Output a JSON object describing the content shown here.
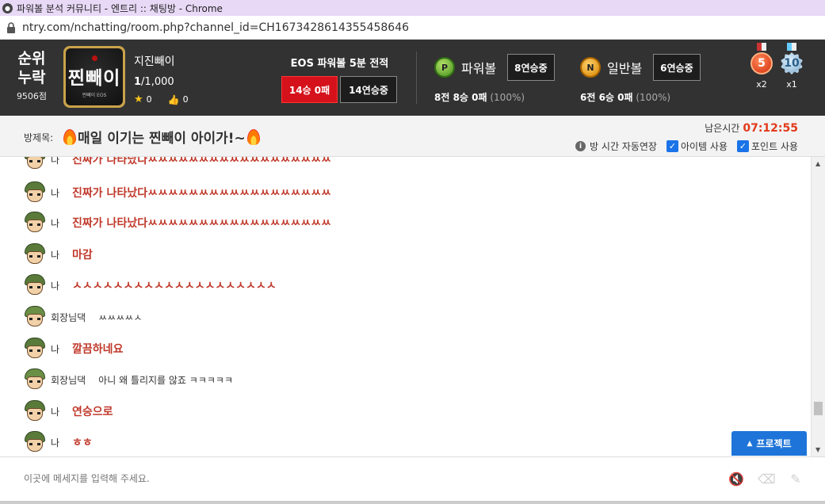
{
  "window": {
    "title": "파워볼 분석 커뮤니티 - 엔트리 :: 채팅방 - Chrome",
    "url": "ntry.com/nchatting/room.php?channel_id=CH1673428614355458646"
  },
  "header": {
    "rank_line1": "순위",
    "rank_line2": "누락",
    "points": "9506점",
    "avatar_text": "찐빼이",
    "avatar_sub": "찐빼이 EOS",
    "nickname": "지진빼이",
    "level_cur": "1",
    "level_rest": "/1,000",
    "stars": "0",
    "likes": "0",
    "eos_title": "EOS 파워볼 5분 전적",
    "eos_record": "14승 0패",
    "eos_streak": "14연승중",
    "powerball": {
      "badge": "P",
      "label": "파워볼",
      "streak": "8연승중",
      "rec_a": "8전 ",
      "rec_b": "8승 0패",
      "pct": " (100%)"
    },
    "normalball": {
      "badge": "N",
      "label": "일반볼",
      "streak": "6연승중",
      "rec_a": "6전 ",
      "rec_b": "6승 0패",
      "pct": " (100%)"
    },
    "medals": [
      {
        "num": "5",
        "count": "x2"
      },
      {
        "num": "10",
        "count": "x1"
      }
    ]
  },
  "room": {
    "label": "방제목:",
    "title": "매일 이기는 찐빼이 아이가!~",
    "remain_label": "남은시간",
    "remain_time": "07:12:55",
    "auto_extend": "방 시간 자동연장",
    "item_use": "아이템 사용",
    "point_use": "포인트 사용"
  },
  "messages": [
    {
      "who": "나",
      "text": "진짜가 나타났다ㅆㅆㅆㅆㅆㅆㅆㅆㅆㅆㅆㅆㅆㅆㅆㅆㅆㅆ",
      "me": true
    },
    {
      "who": "나",
      "text": "진짜가 나타났다ㅆㅆㅆㅆㅆㅆㅆㅆㅆㅆㅆㅆㅆㅆㅆㅆㅆㅆ",
      "me": true
    },
    {
      "who": "나",
      "text": "진짜가 나타났다ㅆㅆㅆㅆㅆㅆㅆㅆㅆㅆㅆㅆㅆㅆㅆㅆㅆㅆ",
      "me": true
    },
    {
      "who": "나",
      "text": "마감",
      "me": true
    },
    {
      "who": "나",
      "text": "ㅅㅅㅅㅅㅅㅅㅅㅅㅅㅅㅅㅅㅅㅅㅅㅅㅅㅅㅅㅅ",
      "me": true
    },
    {
      "who": "회장님댁",
      "text": "ㅆㅆㅆㅆㅅ",
      "me": false
    },
    {
      "who": "나",
      "text": "깔끔하네요",
      "me": true
    },
    {
      "who": "회장님댁",
      "text": "아니 왜 틀리지를 않죠 ㅋㅋㅋㅋㅋ",
      "me": false
    },
    {
      "who": "나",
      "text": "연승으로",
      "me": true
    },
    {
      "who": "나",
      "text": "ㅎㅎ",
      "me": true
    }
  ],
  "project_button": "프로젝트",
  "input": {
    "placeholder": "이곳에 메세지를 입력해 주세요."
  }
}
